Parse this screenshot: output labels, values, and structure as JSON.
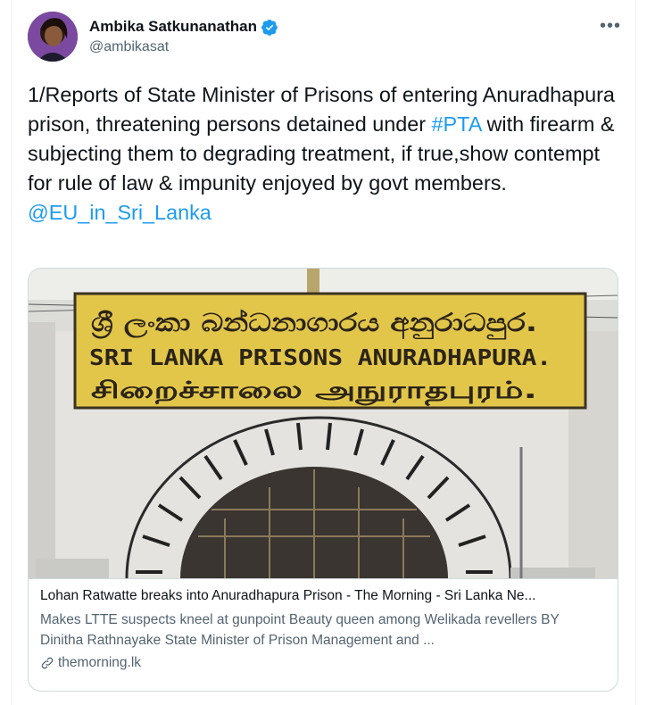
{
  "author": {
    "name": "Ambika Satkunanathan",
    "handle": "@ambikasat"
  },
  "more_label": "•••",
  "tweet": {
    "text_before": "1/Reports of State Minister of Prisons of entering Anuradhapura prison, threatening persons detained under ",
    "hashtag": "#PTA",
    "text_after": " with firearm & subjecting them to degrading treatment, if true,show contempt for rule of law & impunity enjoyed by govt members.",
    "mention": "@EU_in_Sri_Lanka"
  },
  "card": {
    "sign_line_1": "ශ්‍රී ලංකා බන්ධනාගාරය අනුරාධපුර.",
    "sign_line_2": "SRI LANKA PRISONS ANURADHAPURA.",
    "sign_line_3": "சிறைச்சாலை அநுராதபுரம்.",
    "title": "Lohan Ratwatte breaks into Anuradhapura Prison - The Morning - Sri Lanka Ne...",
    "description": "Makes LTTE suspects kneel at gunpoint  Beauty queen among Welikada revellers   BY Dinitha Rathnayake State Minister of Prison Management and ...",
    "domain": "themorning.lk"
  },
  "colors": {
    "link": "#1d9bf0",
    "verified": "#1d9bf0",
    "sign_yellow": "#e2c64a"
  },
  "icons": [
    "verified-badge-icon",
    "more-icon",
    "link-icon"
  ]
}
